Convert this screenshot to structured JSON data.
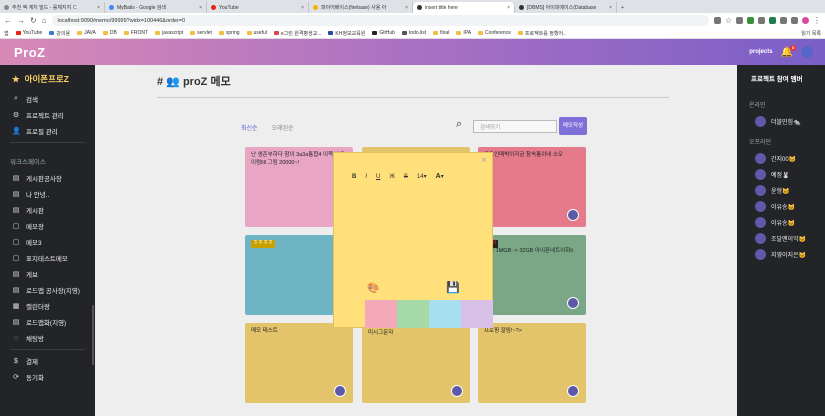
{
  "browser": {
    "tabs": [
      {
        "label": "추천 액 계치 빌드 - 롤체지지 ㄷ",
        "active": false
      },
      {
        "label": "MyBatis - Google 검색",
        "active": false
      },
      {
        "label": "YouTube",
        "active": false
      },
      {
        "label": "파이어베이스(firebase) 사용 아",
        "active": false
      },
      {
        "label": "insert title here",
        "active": true
      },
      {
        "label": "[DBMS] 아이피에이스(Database",
        "active": false
      }
    ],
    "url": "localhost:9090/memo/99999?widx=100446&order=0",
    "bookmarks": [
      "앱",
      "YouTube",
      "강의용",
      "JAVA",
      "DB",
      "FRONT",
      "javascript",
      "servlet",
      "spring",
      "useful",
      "e그린 원격평생교...",
      "KH정보교육원",
      "GitHub",
      "todo.list",
      "final",
      "IPA",
      "Conference",
      "프로젝트를 정했어..",
      "읽기 목록"
    ]
  },
  "header": {
    "logo": "ProZ",
    "projects_label": "projects",
    "notification_count": "0"
  },
  "sidebar": {
    "workspace": "아이폰프로Z",
    "top_items": [
      {
        "icon": "search-icon",
        "label": "검색"
      },
      {
        "icon": "gear-icon",
        "label": "프로젝트 관리"
      },
      {
        "icon": "user-icon",
        "label": "프로필 관리"
      }
    ],
    "section_label": "워크스페이스",
    "workspace_items": [
      {
        "icon": "board-icon",
        "label": "게시판공사장"
      },
      {
        "icon": "board-icon",
        "label": "나 안녕.."
      },
      {
        "icon": "board-icon",
        "label": "게시판"
      },
      {
        "icon": "memo-icon",
        "label": "메모장"
      },
      {
        "icon": "memo-icon",
        "label": "메모3"
      },
      {
        "icon": "memo-icon",
        "label": "표지테스트메모"
      },
      {
        "icon": "board-icon",
        "label": "게보"
      },
      {
        "icon": "board-icon",
        "label": "로드맵 공사장(지영)"
      },
      {
        "icon": "calendar-icon",
        "label": "캘린더랑"
      },
      {
        "icon": "board-icon",
        "label": "로드맵화(지영)"
      },
      {
        "icon": "chat-icon",
        "label": "채팅방"
      }
    ],
    "bottom_items": [
      {
        "icon": "dollar-icon",
        "label": "결제"
      },
      {
        "icon": "sync-icon",
        "label": "동기화"
      }
    ]
  },
  "main": {
    "title": "proZ 메모",
    "sort_latest": "최신순",
    "sort_oldest": "오래된순",
    "search_placeholder": "검색하기",
    "write_button": "메모작성",
    "cards": [
      {
        "text": "난 생존부하다 참이 3a3a통합4 이쪽서 되이럼llll 그림 20000~!",
        "color": "#e8a6c4"
      },
      {
        "text": "",
        "color": "#e3c46a"
      },
      {
        "text": "로그인메박이지금 참속통이네 소오",
        "color": "#e57a8a"
      },
      {
        "text": "ㅎㅎㅎㅎ",
        "color": "#6fb4c4"
      },
      {
        "text": "",
        "color": "#e3c46a"
      },
      {
        "text": "메모 1MGB -> 32GB 아이폰네트이화li",
        "color": "#7aa886"
      },
      {
        "text": "메모 테스트",
        "color": "#e3c46a"
      },
      {
        "text": "미시그문자",
        "color": "#e3c46a"
      },
      {
        "text": "프로핑 잘림!~?>",
        "color": "#e3c46a"
      }
    ],
    "card_highlight_label": "ㅎㅎㅎㅎ",
    "card_dark_label": "장이"
  },
  "right_panel": {
    "title": "프로젝트 참여 멤버",
    "online_label": "온라인",
    "online_members": [
      "더블민힘🐀"
    ],
    "offline_label": "오프라인",
    "offline_members": [
      "간지00🐱",
      "예정🐰",
      "윤형🐱",
      "이유송🐱",
      "이유송🐱",
      "조달맨이익🐱",
      "지영이지은🐱"
    ]
  },
  "modal": {
    "close": "×",
    "tools": [
      "B",
      "I",
      "U",
      "Ж",
      "S",
      "14",
      "A"
    ],
    "swatch_colors": [
      "#f4a9b8",
      "#a6d9a8",
      "#a8dff0",
      "#d9c0e6"
    ]
  }
}
